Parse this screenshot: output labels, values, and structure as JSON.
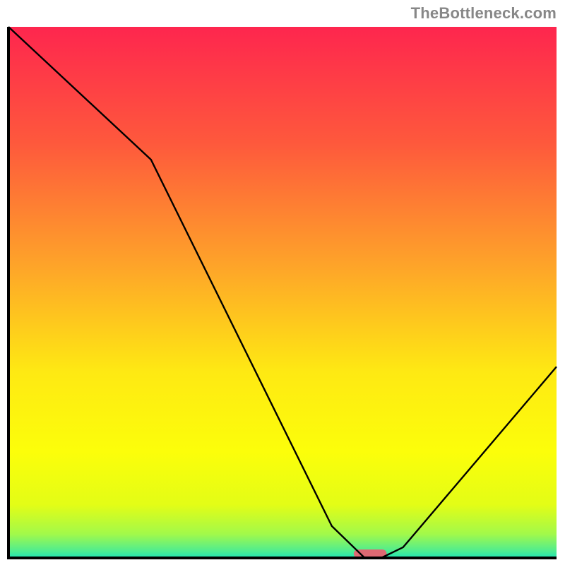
{
  "watermark": "TheBottleneck.com",
  "chart_data": {
    "type": "line",
    "title": "",
    "xlabel": "",
    "ylabel": "",
    "xlim": [
      0,
      100
    ],
    "ylim": [
      0,
      100
    ],
    "series": [
      {
        "name": "bottleneck-curve",
        "x": [
          0,
          26,
          59,
          65,
          68,
          72,
          100
        ],
        "values": [
          100,
          75,
          6,
          0,
          0,
          2,
          36
        ]
      }
    ],
    "marker": {
      "name": "current-gpu",
      "x_center": 66,
      "width": 6,
      "color": "#de6973"
    },
    "background": {
      "type": "vertical-gradient",
      "stops": [
        {
          "pos": 0.0,
          "color": "#fe264e"
        },
        {
          "pos": 0.22,
          "color": "#fe593c"
        },
        {
          "pos": 0.45,
          "color": "#fea429"
        },
        {
          "pos": 0.65,
          "color": "#fee913"
        },
        {
          "pos": 0.8,
          "color": "#fcfe0a"
        },
        {
          "pos": 0.9,
          "color": "#e3fd16"
        },
        {
          "pos": 0.955,
          "color": "#a2f94a"
        },
        {
          "pos": 0.985,
          "color": "#54ed8c"
        },
        {
          "pos": 1.0,
          "color": "#1fe4b4"
        }
      ]
    },
    "axes_color": "#000000"
  }
}
